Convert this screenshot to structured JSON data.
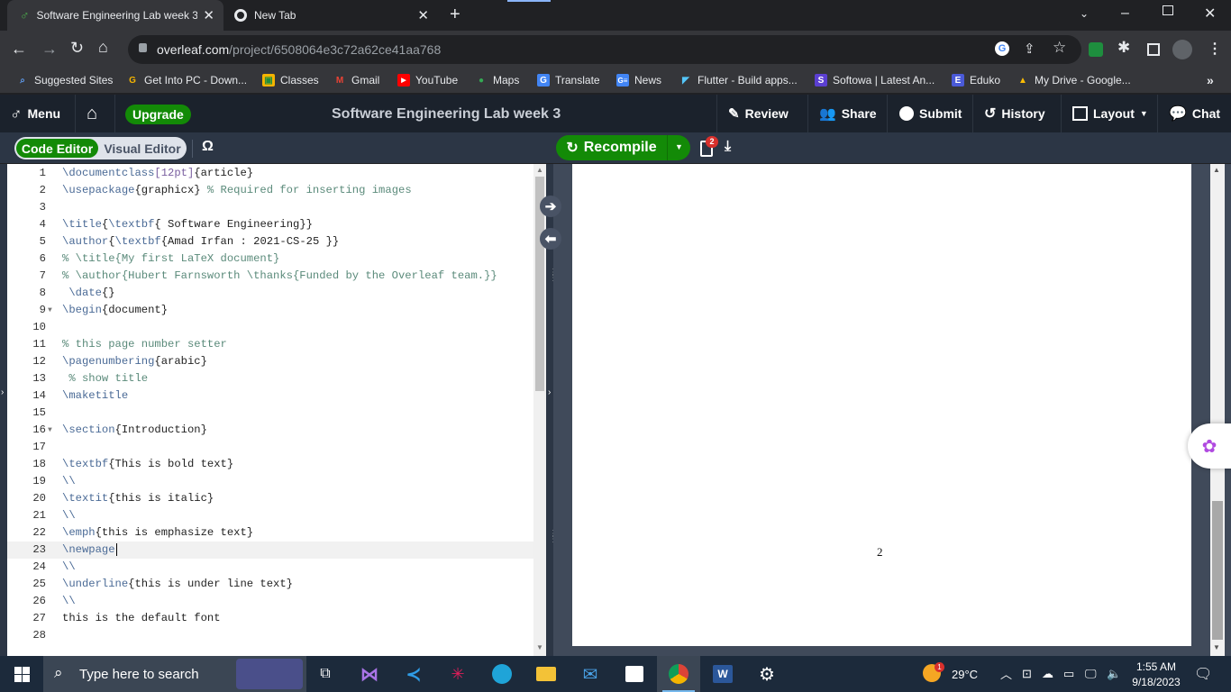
{
  "browser": {
    "tabs": [
      {
        "title": "Software Engineering Lab week 3",
        "active": true
      },
      {
        "title": "New Tab",
        "active": false
      }
    ],
    "new_tab": "+",
    "close_glyph": "✕",
    "url_host": "overleaf.com",
    "url_path": "/project/6508064e3c72a62ce41aa768",
    "bookmarks": [
      {
        "label": "Suggested Sites",
        "icon": "suggested-sites-icon"
      },
      {
        "label": "Get Into PC - Down...",
        "icon": "getintopc-icon"
      },
      {
        "label": "Classes",
        "icon": "classes-icon"
      },
      {
        "label": "Gmail",
        "icon": "gmail-icon"
      },
      {
        "label": "YouTube",
        "icon": "youtube-icon"
      },
      {
        "label": "Maps",
        "icon": "maps-icon"
      },
      {
        "label": "Translate",
        "icon": "translate-icon"
      },
      {
        "label": "News",
        "icon": "news-icon"
      },
      {
        "label": "Flutter - Build apps...",
        "icon": "flutter-icon"
      },
      {
        "label": "Softowa | Latest An...",
        "icon": "softowa-icon"
      },
      {
        "label": "Eduko",
        "icon": "eduko-icon"
      },
      {
        "label": "My Drive - Google...",
        "icon": "drive-icon"
      }
    ],
    "more_bookmarks": "»"
  },
  "overleaf": {
    "menu_label": "Menu",
    "upgrade_label": "Upgrade",
    "project_title": "Software Engineering Lab week 3",
    "header_buttons": {
      "review": "Review",
      "share": "Share",
      "submit": "Submit",
      "history": "History",
      "layout": "Layout",
      "chat": "Chat"
    },
    "editor_modes": {
      "code": "Code Editor",
      "visual": "Visual Editor"
    },
    "symbol_palette": "Ω",
    "recompile_label": "Recompile",
    "log_badge_count": "2",
    "pdf_page_number": "2"
  },
  "code_lines": [
    {
      "n": "1",
      "parts": [
        [
          "kw",
          "\\documentclass"
        ],
        [
          "opt",
          "[12pt]"
        ],
        [
          "txt",
          "{article}"
        ]
      ]
    },
    {
      "n": "2",
      "parts": [
        [
          "kw",
          "\\usepackage"
        ],
        [
          "txt",
          "{graphicx} "
        ],
        [
          "cm",
          "% Required for inserting images"
        ]
      ]
    },
    {
      "n": "3",
      "parts": []
    },
    {
      "n": "4",
      "parts": [
        [
          "kw",
          "\\title"
        ],
        [
          "txt",
          "{"
        ],
        [
          "kw",
          "\\textbf"
        ],
        [
          "txt",
          "{ Software Engineering}}"
        ]
      ]
    },
    {
      "n": "5",
      "parts": [
        [
          "kw",
          "\\author"
        ],
        [
          "txt",
          "{"
        ],
        [
          "kw",
          "\\textbf"
        ],
        [
          "txt",
          "{Amad Irfan : 2021-CS-25 }}"
        ]
      ]
    },
    {
      "n": "6",
      "parts": [
        [
          "cm",
          "% \\title{My first LaTeX document}"
        ]
      ]
    },
    {
      "n": "7",
      "parts": [
        [
          "cm",
          "% \\author{Hubert Farnsworth \\thanks{Funded by the Overleaf team.}}"
        ]
      ]
    },
    {
      "n": "8",
      "parts": [
        [
          "kw",
          " \\date"
        ],
        [
          "txt",
          "{}"
        ]
      ]
    },
    {
      "n": "9",
      "fold": true,
      "parts": [
        [
          "kw",
          "\\begin"
        ],
        [
          "txt",
          "{document}"
        ]
      ]
    },
    {
      "n": "10",
      "parts": []
    },
    {
      "n": "11",
      "parts": [
        [
          "cm",
          "% this page number setter"
        ]
      ]
    },
    {
      "n": "12",
      "parts": [
        [
          "kw",
          "\\pagenumbering"
        ],
        [
          "txt",
          "{arabic}"
        ]
      ]
    },
    {
      "n": "13",
      "parts": [
        [
          "cm",
          " % show title"
        ]
      ]
    },
    {
      "n": "14",
      "parts": [
        [
          "kw",
          "\\maketitle"
        ]
      ]
    },
    {
      "n": "15",
      "parts": []
    },
    {
      "n": "16",
      "fold": true,
      "parts": [
        [
          "kw",
          "\\section"
        ],
        [
          "txt",
          "{Introduction}"
        ]
      ]
    },
    {
      "n": "17",
      "parts": []
    },
    {
      "n": "18",
      "parts": [
        [
          "kw",
          "\\textbf"
        ],
        [
          "txt",
          "{This is bold text}"
        ]
      ]
    },
    {
      "n": "19",
      "parts": [
        [
          "kw",
          "\\\\"
        ]
      ]
    },
    {
      "n": "20",
      "parts": [
        [
          "kw",
          "\\textit"
        ],
        [
          "txt",
          "{this is italic}"
        ]
      ]
    },
    {
      "n": "21",
      "parts": [
        [
          "kw",
          "\\\\"
        ]
      ]
    },
    {
      "n": "22",
      "parts": [
        [
          "kw",
          "\\emph"
        ],
        [
          "txt",
          "{this is emphasize text}"
        ]
      ]
    },
    {
      "n": "23",
      "current": true,
      "parts": [
        [
          "kw",
          "\\newpage"
        ]
      ]
    },
    {
      "n": "24",
      "parts": [
        [
          "kw",
          "\\\\"
        ]
      ]
    },
    {
      "n": "25",
      "parts": [
        [
          "kw",
          "\\underline"
        ],
        [
          "txt",
          "{this is under line text}"
        ]
      ]
    },
    {
      "n": "26",
      "parts": [
        [
          "kw",
          "\\\\"
        ]
      ]
    },
    {
      "n": "27",
      "parts": [
        [
          "txt",
          "this is the default font"
        ]
      ]
    },
    {
      "n": "28",
      "parts": []
    }
  ],
  "taskbar": {
    "search_placeholder": "Type here to search",
    "weather": "29°C",
    "weather_badge": "1",
    "time": "1:55 AM",
    "date": "9/18/2023"
  },
  "colors": {
    "overleaf_green": "#138a07",
    "header_bg": "#1b222c",
    "toolbar_bg": "#2c3645"
  }
}
